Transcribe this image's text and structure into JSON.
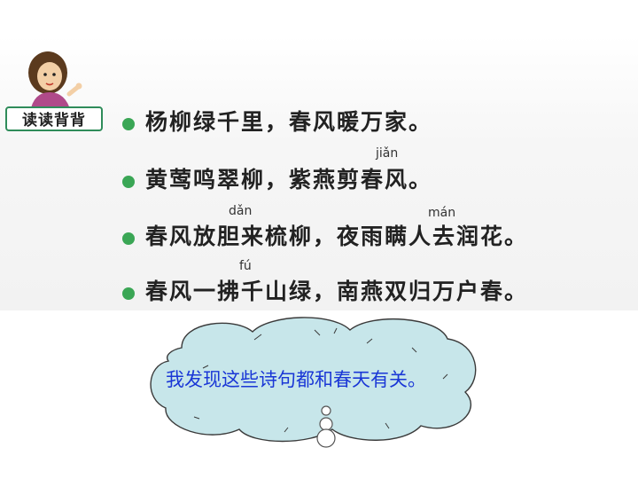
{
  "badge": {
    "label": "读读背背"
  },
  "poem": [
    {
      "text": "杨柳绿千里，春风暖万家。"
    },
    {
      "text": "黄莺鸣翠柳，紫燕剪春风。",
      "pinyin": [
        "jiǎn"
      ]
    },
    {
      "text": "春风放胆来梳柳，夜雨瞒人去润花。",
      "pinyin": [
        "dǎn",
        "mán"
      ]
    },
    {
      "text": "春风一拂千山绿，南燕双归万户春。",
      "pinyin": [
        "fú"
      ]
    }
  ],
  "thought": {
    "text": "我发现这些诗句都和春天有关。"
  },
  "colors": {
    "bullet": "#3aa655",
    "thought_text": "#1a37d6",
    "cloud_fill": "#c7e6ea",
    "badge_border": "#2f8c5a"
  }
}
